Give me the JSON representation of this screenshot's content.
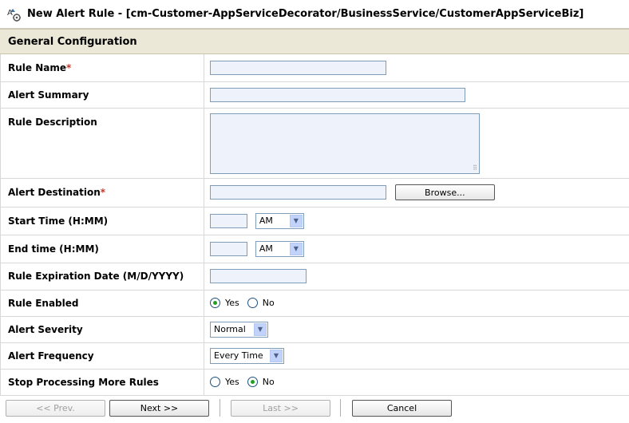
{
  "title": "New Alert Rule - [cm-Customer-AppServiceDecorator/BusinessService/CustomerAppServiceBiz]",
  "section": "General Configuration",
  "fields": {
    "rule_name": {
      "label": "Rule Name",
      "required": "*",
      "value": ""
    },
    "alert_summary": {
      "label": "Alert Summary",
      "value": ""
    },
    "rule_description": {
      "label": "Rule Description",
      "value": ""
    },
    "alert_destination": {
      "label": "Alert Destination",
      "required": "*",
      "value": "",
      "browse_label": "Browse..."
    },
    "start_time": {
      "label": "Start Time (H:MM)",
      "value": "",
      "ampm": "AM"
    },
    "end_time": {
      "label": "End time (H:MM)",
      "value": "",
      "ampm": "AM"
    },
    "expiration": {
      "label": "Rule Expiration Date (M/D/YYYY)",
      "value": ""
    },
    "rule_enabled": {
      "label": "Rule Enabled",
      "yes": "Yes",
      "no": "No",
      "selected": "Yes"
    },
    "alert_severity": {
      "label": "Alert Severity",
      "value": "Normal"
    },
    "alert_frequency": {
      "label": "Alert Frequency",
      "value": "Every Time"
    },
    "stop_processing": {
      "label": "Stop Processing More Rules",
      "yes": "Yes",
      "no": "No",
      "selected": "No"
    }
  },
  "footer": {
    "prev": "<< Prev.",
    "next": "Next >>",
    "last": "Last >>",
    "cancel": "Cancel"
  },
  "colors": {
    "section_bg": "#ece8d8",
    "input_bg": "#eef3fb",
    "required": "#c0392b",
    "radio_dot": "#21a121"
  },
  "icons": {
    "title": "alert-rule-icon",
    "dropdown": "chevron-down-icon",
    "resize": "resize-grip-icon"
  }
}
